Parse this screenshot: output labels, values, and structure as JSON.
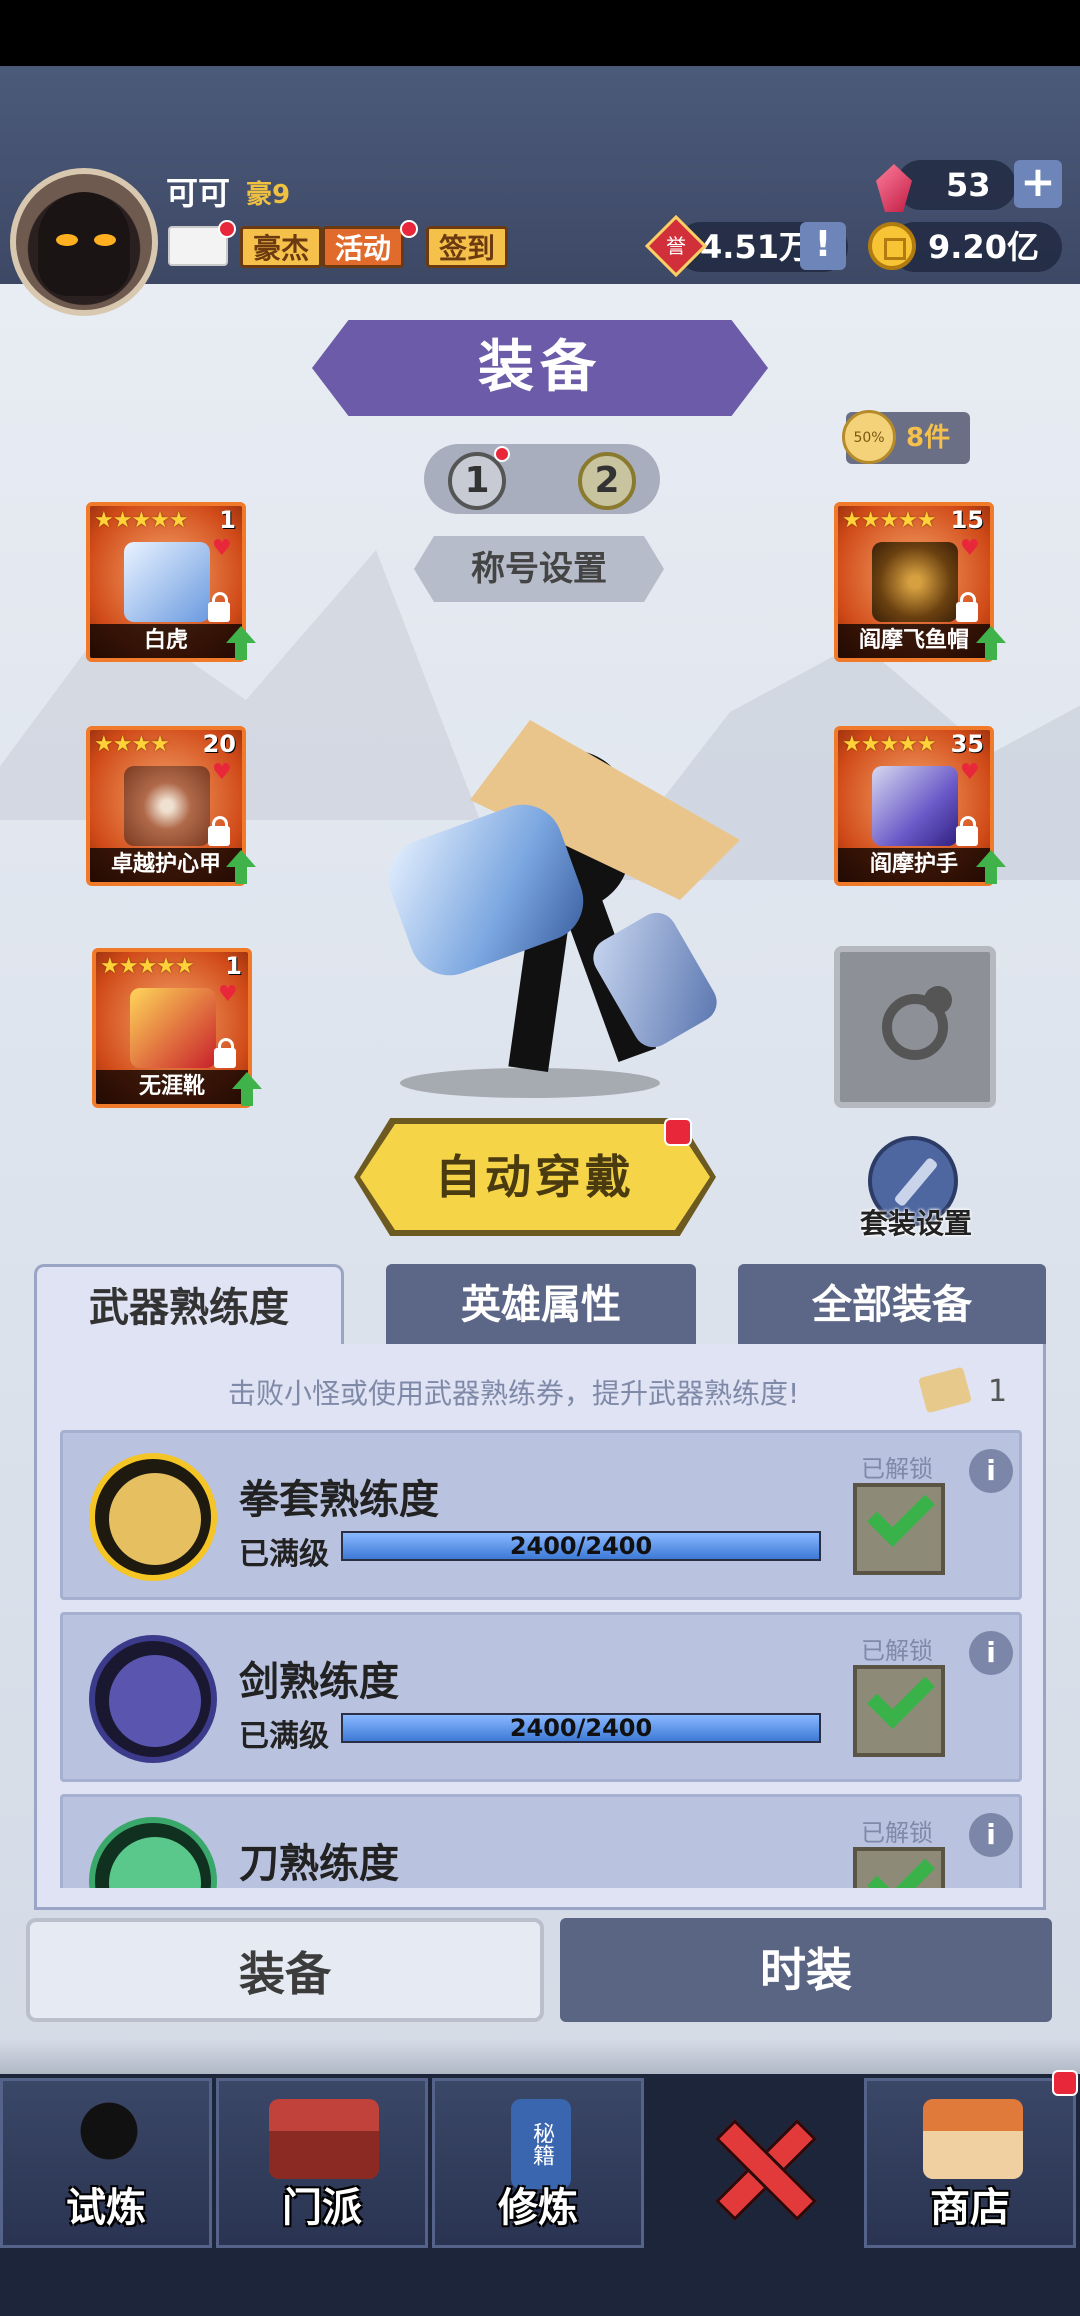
{
  "player": {
    "name": "可可",
    "rank": "豪9"
  },
  "header_tags": {
    "hero": "豪杰",
    "activity": "活动",
    "signin": "签到"
  },
  "resources": {
    "gems": "53",
    "honor": "4.51万",
    "coins": "9.20亿",
    "honor_icon": "誉"
  },
  "page_title": "装备",
  "set_badge": {
    "label": "8件",
    "icon_text": "50%"
  },
  "page_switch": [
    "1",
    "2"
  ],
  "title_setting": "称号设置",
  "equipment_left": [
    {
      "name": "白虎",
      "stars": "★★★★★",
      "level": "1",
      "art": "#9ec4f0"
    },
    {
      "name": "卓越护心甲",
      "stars": "★★★★",
      "level": "20",
      "art": "#c07a5a"
    },
    {
      "name": "无涯靴",
      "stars": "★★★★★",
      "level": "1",
      "art": "#f0b030"
    }
  ],
  "equipment_right": [
    {
      "name": "阎摩飞鱼帽",
      "stars": "★★★★★",
      "level": "15",
      "art": "#8a5a20"
    },
    {
      "name": "阎摩护手",
      "stars": "★★★★★",
      "level": "35",
      "art": "#7c6cd0"
    }
  ],
  "auto_equip": "自动穿戴",
  "suit_setting": "套装设置",
  "tabs": [
    "武器熟练度",
    "英雄属性",
    "全部装备"
  ],
  "hint": "击败小怪或使用武器熟练券，提升武器熟练度!",
  "scroll_count": "1",
  "proficiency": [
    {
      "title": "拳套熟练度",
      "status": "已满级",
      "progress": "2400/2400",
      "fill": 1.0,
      "unlock": "已解锁",
      "color": "#f4c524"
    },
    {
      "title": "剑熟练度",
      "status": "已满级",
      "progress": "2400/2400",
      "fill": 1.0,
      "unlock": "已解锁",
      "color": "#3c3a8a"
    },
    {
      "title": "刀熟练度",
      "status": "",
      "progress": "",
      "fill": 0,
      "unlock": "已解锁",
      "color": "#3aa86a"
    }
  ],
  "bottom_tabs": {
    "equip": "装备",
    "fashion": "时装"
  },
  "nav": [
    {
      "label": "试炼",
      "icon": "ninja-icon"
    },
    {
      "label": "门派",
      "icon": "temple-icon"
    },
    {
      "label": "修炼",
      "icon": "book-icon",
      "book_text": "秘籍"
    },
    {
      "label": "",
      "icon": "close-icon"
    },
    {
      "label": "商店",
      "icon": "shop-icon"
    }
  ]
}
